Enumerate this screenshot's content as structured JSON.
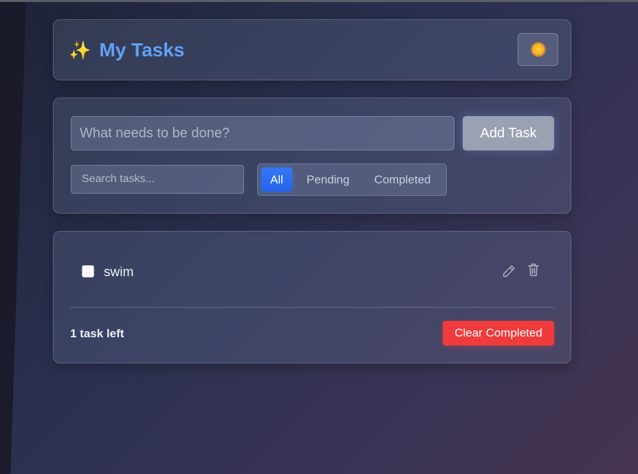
{
  "header": {
    "title_icon": "✨",
    "title": "My Tasks",
    "theme_toggle_icon": "sun-icon"
  },
  "composer": {
    "task_placeholder": "What needs to be done?",
    "task_value": "",
    "add_button_label": "Add Task"
  },
  "search": {
    "placeholder": "Search tasks...",
    "value": ""
  },
  "filters": {
    "items": [
      {
        "label": "All",
        "active": true
      },
      {
        "label": "Pending",
        "active": false
      },
      {
        "label": "Completed",
        "active": false
      }
    ]
  },
  "tasks": {
    "items": [
      {
        "text": "swim",
        "completed": false
      }
    ]
  },
  "footer": {
    "tasks_left": "1 task left",
    "clear_button_label": "Clear Completed"
  },
  "colors": {
    "accent_blue": "#3b82f6",
    "title_blue": "#5ea2f6",
    "danger_red": "#ef3b3b"
  }
}
